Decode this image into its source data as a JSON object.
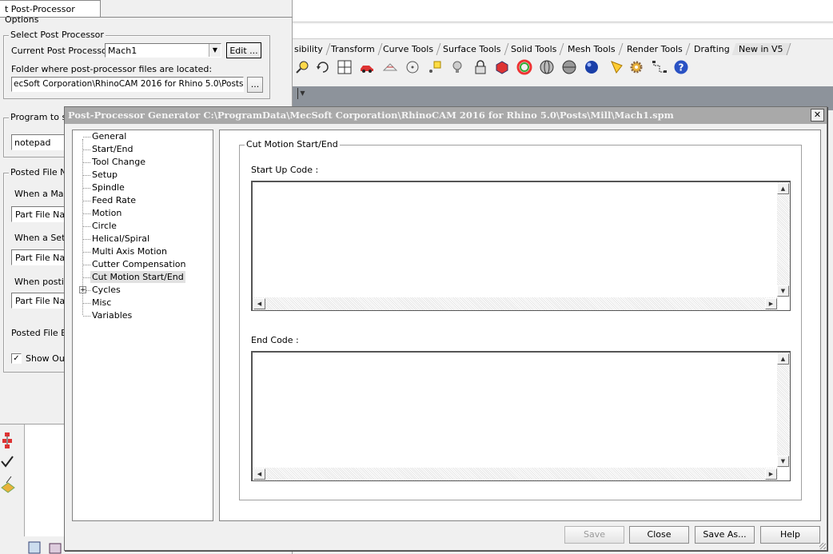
{
  "background_app": {
    "tabs": [
      "sibility",
      "Transform",
      "Curve Tools",
      "Surface Tools",
      "Solid Tools",
      "Mesh Tools",
      "Render Tools",
      "Drafting",
      "New in V5"
    ]
  },
  "post_options": {
    "tab_label": "t Post-Processor Options",
    "select_group": "Select Post Processor",
    "current_label": "Current Post Processor:",
    "current_value": "Mach1",
    "edit_button": "Edit ...",
    "folder_label": "Folder where post-processor files are located:",
    "folder_value": "ecSoft Corporation\\RhinoCAM 2016 for Rhino 5.0\\Posts\\Mill",
    "browse_button": "...",
    "program_group": "Program to ser",
    "program_value": "notepad",
    "posted_group": "Posted File Na",
    "when_mac": "When a Mac",
    "when_setu": "When a Setu",
    "when_postin": "When postin",
    "part_file_1": "Part File Nan",
    "part_file_2": "Part File Nan",
    "part_file_3": "Part File Nan",
    "posted_ext": "Posted File Ex",
    "show_out": "Show Out"
  },
  "dialog": {
    "title": "Post-Processor Generator  C:\\ProgramData\\MecSoft Corporation\\RhinoCAM 2016 for Rhino 5.0\\Posts\\Mill\\Mach1.spm",
    "close_glyph": "✕",
    "tree": [
      "General",
      "Start/End",
      "Tool Change",
      "Setup",
      "Spindle",
      "Feed Rate",
      "Motion",
      "Circle",
      "Helical/Spiral",
      "Multi Axis Motion",
      "Cutter Compensation",
      "Cut Motion Start/End",
      "Cycles",
      "Misc",
      "Variables"
    ],
    "tree_selected_index": 11,
    "expander_glyph": "+",
    "group_title": "Cut Motion Start/End",
    "start_label": "Start Up Code :",
    "start_value": "",
    "end_label": "End Code :",
    "end_value": "",
    "buttons": {
      "save": "Save",
      "close": "Close",
      "save_as": "Save As...",
      "help": "Help"
    }
  },
  "colors": {
    "title_bar": "#a9a9a9",
    "title_text": "#f4f4f4",
    "selection": "#e1e1e1",
    "viewport": "#8d939b"
  }
}
